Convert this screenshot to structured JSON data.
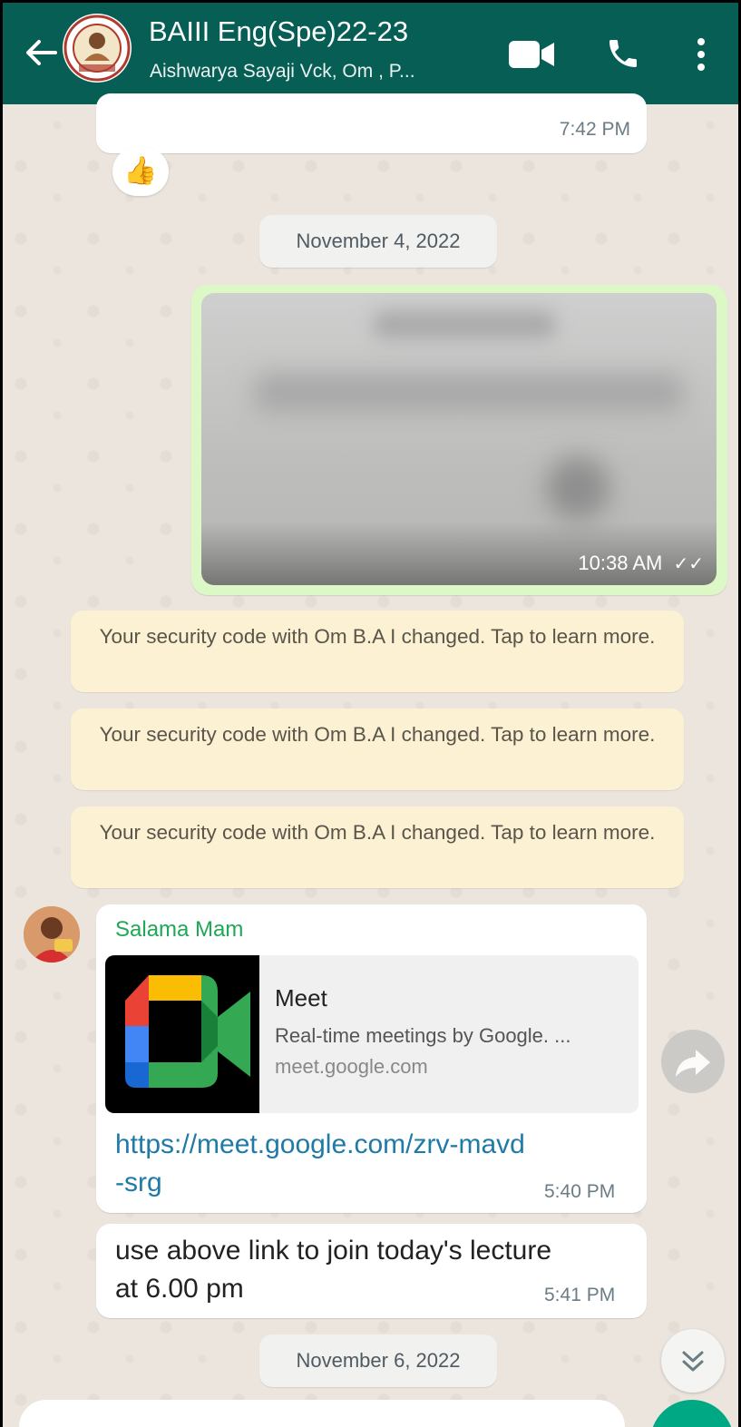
{
  "header": {
    "title": "BAIII Eng(Spe)22-23",
    "subtitle": "Aishwarya Sayaji Vck, Om , P...",
    "color": "#075e54"
  },
  "messages": {
    "top_time": "7:42 PM",
    "reaction_emoji": "👍",
    "date1": "November 4, 2022",
    "image_time": "10:38 AM",
    "image_ticks": "✓✓",
    "security_notices": [
      "Your security code with Om B.A I changed. Tap to learn more.",
      "Your security code with Om B.A I changed. Tap to learn more.",
      "Your security code with Om B.A I changed. Tap to learn more."
    ],
    "sender": "Salama Mam",
    "preview_title": "Meet",
    "preview_desc": "Real-time meetings by Google. ...",
    "preview_domain": "meet.google.com",
    "link_line1": "https://meet.google.com/zrv-mavd",
    "link_line2": "-srg",
    "link_time": "5:40 PM",
    "text_line1": "use above link to join today's lecture",
    "text_line2": "at 6.00 pm",
    "text_time": "5:41 PM",
    "date2": "November 6, 2022"
  },
  "icons": [
    "back-arrow-icon",
    "video-call-icon",
    "phone-icon",
    "more-vert-icon",
    "forward-icon",
    "double-chevron-down-icon",
    "google-meet-logo"
  ]
}
